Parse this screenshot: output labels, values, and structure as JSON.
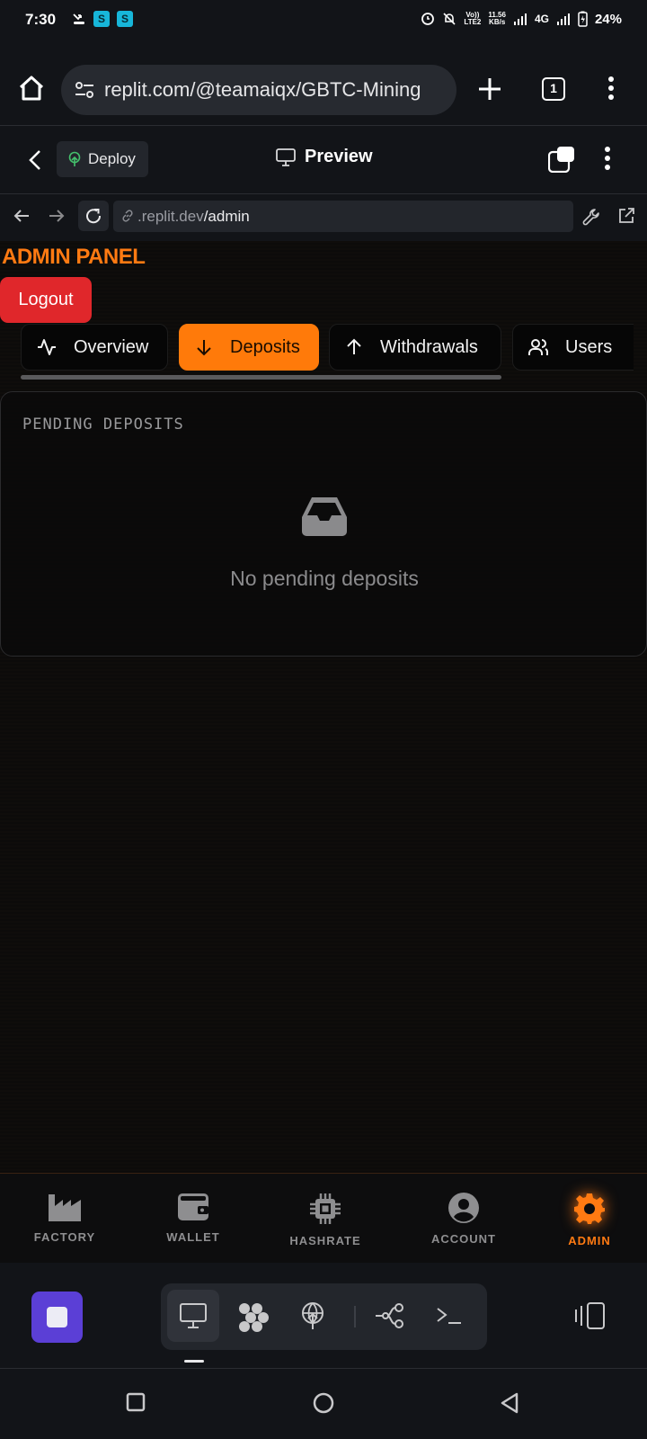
{
  "status_bar": {
    "time": "7:30",
    "network_line1": "Vo))",
    "network_line2": "LTE2",
    "speed_line1": "11.56",
    "speed_line2": "KB/s",
    "network_type": "4G",
    "battery": "24%",
    "app_icon_letter": "S"
  },
  "browser": {
    "url": "replit.com/@teamaiqx/GBTC-Mining",
    "tab_count": "1"
  },
  "replit_header": {
    "deploy_label": "Deploy",
    "preview_label": "Preview"
  },
  "devbar": {
    "url_host": ".replit.dev",
    "url_path": "/admin"
  },
  "app": {
    "title": "ADMIN PANEL",
    "logout_label": "Logout",
    "tabs": [
      {
        "label": "Overview",
        "icon": "activity-icon"
      },
      {
        "label": "Deposits",
        "icon": "arrow-down-icon",
        "active": true
      },
      {
        "label": "Withdrawals",
        "icon": "arrow-up-icon"
      },
      {
        "label": "Users",
        "icon": "users-icon"
      }
    ],
    "card": {
      "title": "PENDING DEPOSITS",
      "empty_text": "No pending deposits"
    },
    "nav": [
      {
        "label": "FACTORY",
        "icon": "factory-icon"
      },
      {
        "label": "WALLET",
        "icon": "wallet-icon"
      },
      {
        "label": "HASHRATE",
        "icon": "chip-icon"
      },
      {
        "label": "ACCOUNT",
        "icon": "account-icon"
      },
      {
        "label": "ADMIN",
        "icon": "gear-icon",
        "active": true
      }
    ]
  },
  "colors": {
    "accent": "#ff7a12",
    "logout": "#e0272b",
    "stop_button": "#5b3fd6"
  }
}
